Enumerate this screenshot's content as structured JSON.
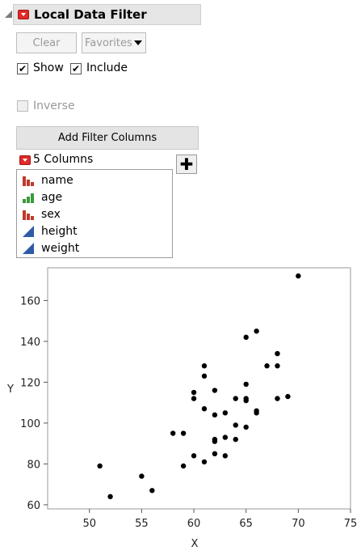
{
  "header": {
    "title": "Local Data Filter"
  },
  "toolbar": {
    "clear_label": "Clear",
    "favorites_label": "Favorites"
  },
  "options": {
    "show": {
      "label": "Show",
      "checked": true
    },
    "include": {
      "label": "Include",
      "checked": true
    },
    "inverse": {
      "label": "Inverse",
      "checked": false,
      "enabled": false
    }
  },
  "add_filter_label": "Add Filter Columns",
  "columns_header": "5 Columns",
  "columns": [
    {
      "label": "name",
      "icon": "nominal-red-bars-icon"
    },
    {
      "label": "age",
      "icon": "ordinal-green-bars-icon"
    },
    {
      "label": "sex",
      "icon": "nominal-red-bars-icon"
    },
    {
      "label": "height",
      "icon": "continuous-blue-triangle-icon"
    },
    {
      "label": "weight",
      "icon": "continuous-blue-triangle-icon"
    }
  ],
  "colors": {
    "nominal": "#c0392b",
    "ordinal": "#3a9a3a",
    "continuous": "#2f5aa8"
  },
  "chart_data": {
    "type": "scatter",
    "xlabel": "X",
    "ylabel": "Y",
    "xlim": [
      46,
      75
    ],
    "ylim": [
      58,
      176
    ],
    "xticks": [
      50,
      55,
      60,
      65,
      70,
      75
    ],
    "yticks": [
      60,
      80,
      100,
      120,
      140,
      160
    ],
    "grid": false,
    "points": [
      [
        51,
        79
      ],
      [
        52,
        64
      ],
      [
        55,
        74
      ],
      [
        56,
        67
      ],
      [
        58,
        95
      ],
      [
        59,
        95
      ],
      [
        59,
        79
      ],
      [
        60,
        115
      ],
      [
        60,
        112
      ],
      [
        60,
        84
      ],
      [
        61,
        128
      ],
      [
        61,
        123
      ],
      [
        61,
        107
      ],
      [
        61,
        81
      ],
      [
        62,
        116
      ],
      [
        62,
        104
      ],
      [
        62,
        92
      ],
      [
        62,
        91
      ],
      [
        62,
        85
      ],
      [
        63,
        105
      ],
      [
        63,
        93
      ],
      [
        63,
        84
      ],
      [
        64,
        112
      ],
      [
        64,
        99
      ],
      [
        64,
        92
      ],
      [
        65,
        142
      ],
      [
        65,
        119
      ],
      [
        65,
        112
      ],
      [
        65,
        111
      ],
      [
        65,
        98
      ],
      [
        66,
        145
      ],
      [
        66,
        106
      ],
      [
        66,
        105
      ],
      [
        67,
        128
      ],
      [
        68,
        134
      ],
      [
        68,
        128
      ],
      [
        68,
        112
      ],
      [
        69,
        113
      ],
      [
        70,
        172
      ]
    ]
  }
}
